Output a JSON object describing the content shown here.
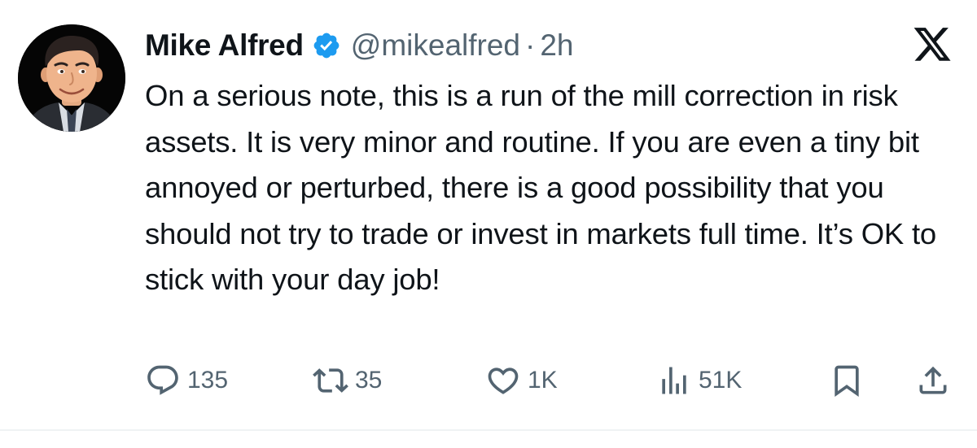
{
  "tweet": {
    "author": {
      "display_name": "Mike Alfred",
      "handle": "@mikealfred",
      "verified": true
    },
    "separator": "·",
    "time": "2h",
    "text": "On a serious note, this is a run of the mill correction in risk assets. It is very minor and routine. If you are even a tiny bit annoyed or perturbed, there is a good possibility that you should not try to trade or invest in markets full time. It’s OK to stick with your day job!",
    "stats": {
      "replies": "135",
      "retweets": "35",
      "likes": "1K",
      "views": "51K"
    }
  },
  "icons": {
    "logo": "x-logo-icon",
    "verified": "verified-badge-icon",
    "reply": "reply-icon",
    "retweet": "retweet-icon",
    "like": "heart-icon",
    "views": "views-icon",
    "bookmark": "bookmark-icon",
    "share": "share-icon"
  },
  "colors": {
    "text": "#0f1419",
    "secondary": "#536471",
    "verified": "#1d9bf0",
    "background": "#ffffff"
  }
}
